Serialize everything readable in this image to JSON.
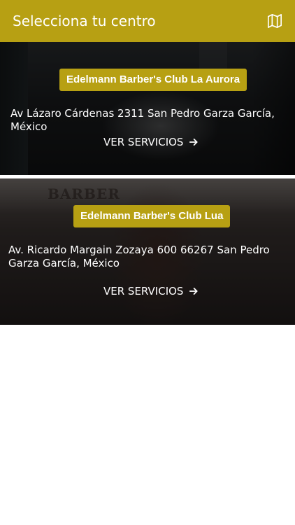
{
  "header": {
    "title": "Selecciona tu centro",
    "map_icon": "map-icon"
  },
  "colors": {
    "accent": "#b7a013",
    "text_light": "#ffffff"
  },
  "centers": [
    {
      "name": "Edelmann Barber's Club La Aurora",
      "address": "Av Lázaro Cárdenas 2311 San Pedro Garza García, México",
      "cta": "VER SERVICIOS"
    },
    {
      "name": "Edelmann Barber's Club Lua",
      "address": "Av. Ricardo Margain Zozaya 600 66267 San Pedro Garza García, México",
      "cta": "VER SERVICIOS",
      "background_sign": "BARBER"
    }
  ]
}
